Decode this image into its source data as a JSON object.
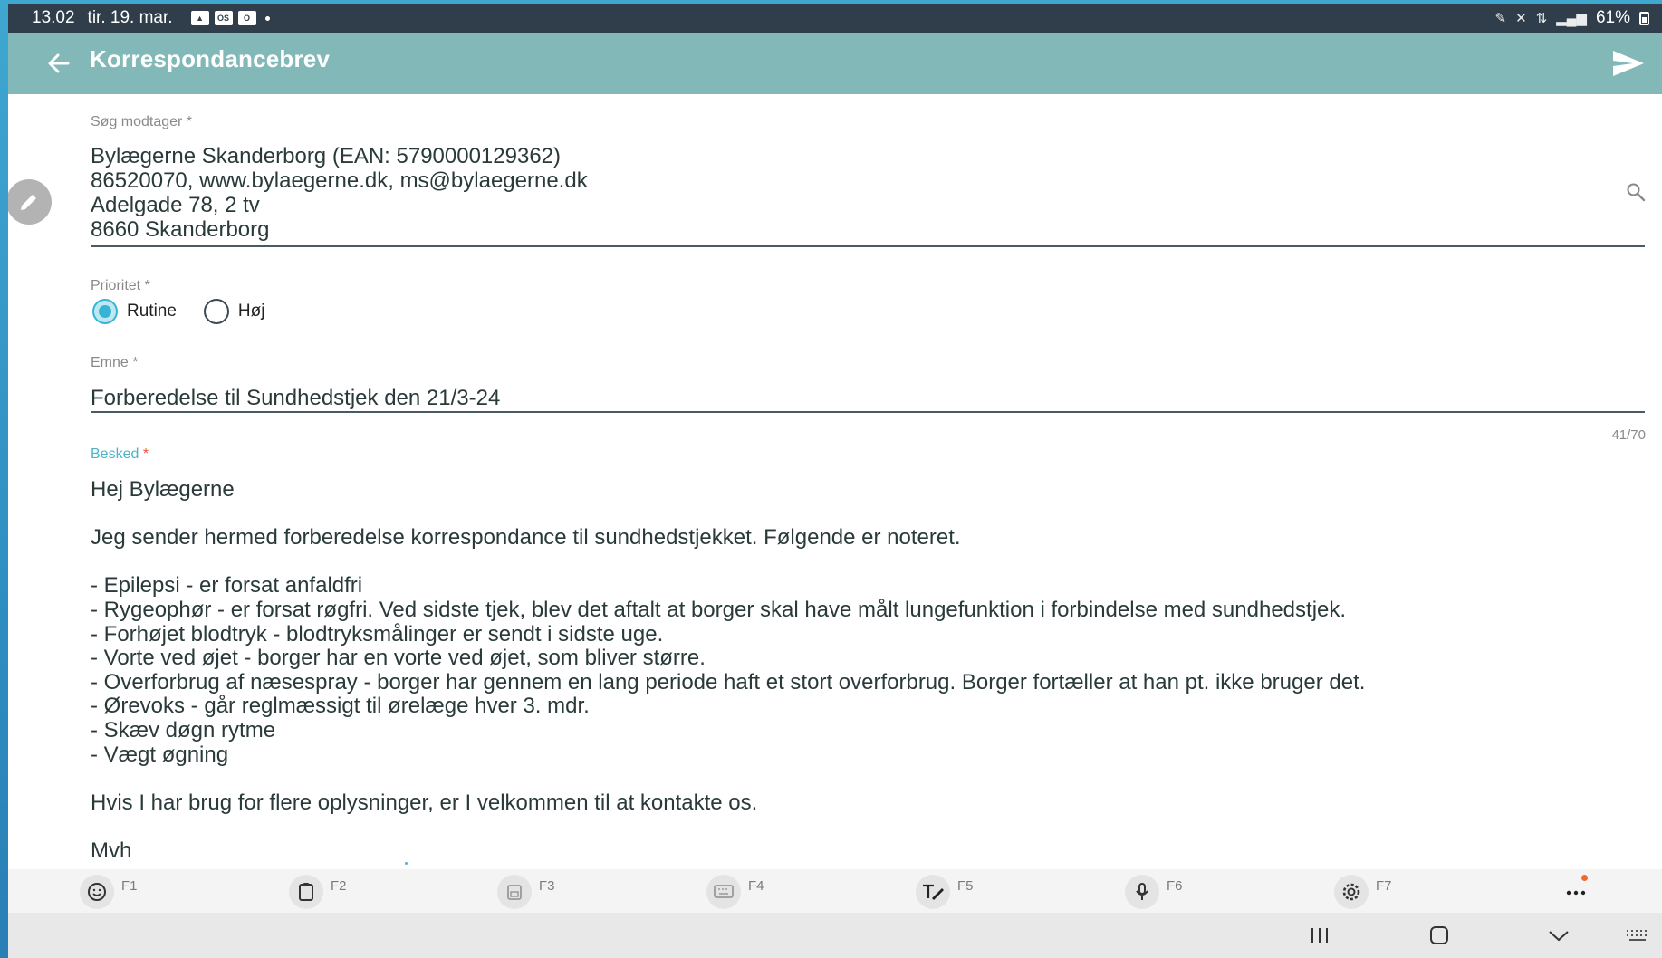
{
  "statusbar": {
    "time": "13.02",
    "date": "tir. 19. mar.",
    "battery": "61%"
  },
  "appbar": {
    "title": "Korrespondancebrev"
  },
  "recipient": {
    "label": "Søg modtager",
    "lines": [
      "Bylægerne Skanderborg (EAN: 5790000129362)",
      "86520070, www.bylaegerne.dk, ms@bylaegerne.dk",
      "Adelgade 78, 2 tv",
      "8660 Skanderborg"
    ]
  },
  "priority": {
    "label": "Prioritet",
    "options": [
      {
        "label": "Rutine",
        "checked": true
      },
      {
        "label": "Høj",
        "checked": false
      }
    ]
  },
  "subject": {
    "label": "Emne",
    "value": "Forberedelse til Sundhedstjek den 21/3-24",
    "counter": "41/70"
  },
  "message": {
    "label": "Besked",
    "lines": [
      "Hej Bylægerne",
      "",
      "Jeg sender hermed forberedelse korrespondance til sundhedstjekket. Følgende er noteret.",
      "",
      "- Epilepsi - er forsat anfaldfri",
      "- Rygeophør - er forsat røgfri. Ved sidste tjek, blev det aftalt at borger skal have målt lungefunktion i forbindelse med sundhedstjek.",
      "- Forhøjet blodtryk - blodtryksmålinger er sendt i sidste uge.",
      "- Vorte ved øjet - borger har en vorte ved øjet, som bliver større.",
      "- Overforbrug af næsespray - borger har gennem en lang periode haft et stort overforbrug. Borger fortæller at han pt. ikke bruger det.",
      "- Ørevoks - går reglmæssigt til ørelæge hver 3. mdr.",
      "- Skæv døgn rytme",
      "- Vægt øgning",
      "",
      "Hvis I har brug for flere oplysninger, er I velkommen til at kontakte os.",
      "",
      "Mvh"
    ]
  },
  "keyboard_toolbar": {
    "items": [
      {
        "label": "F1",
        "icon": "emoji-icon"
      },
      {
        "label": "F2",
        "icon": "clipboard-icon"
      },
      {
        "label": "F3",
        "icon": "one-handed-keyboard-icon"
      },
      {
        "label": "F4",
        "icon": "keyboard-icon"
      },
      {
        "label": "F5",
        "icon": "handwriting-icon"
      },
      {
        "label": "F6",
        "icon": "microphone-icon"
      },
      {
        "label": "F7",
        "icon": "settings-icon"
      }
    ],
    "more_icon": "more-icon"
  },
  "colors": {
    "appbar": "#82b9b8",
    "statusbar": "#2f3e4a",
    "accent": "#36b4d4",
    "required_active": "#e8543c"
  }
}
